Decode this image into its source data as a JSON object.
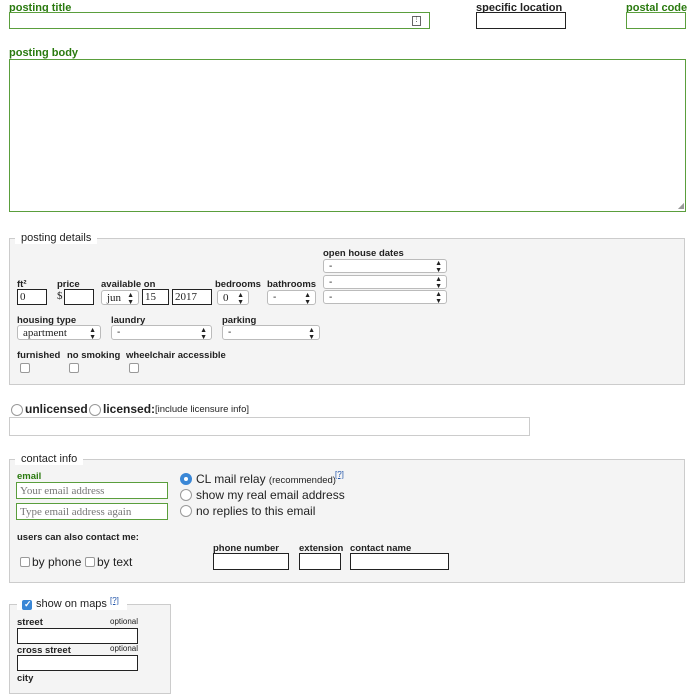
{
  "posting_title": {
    "label": "posting title",
    "value": ""
  },
  "specific_location": {
    "label": "specific location",
    "value": ""
  },
  "postal_code": {
    "label": "postal code",
    "value": ""
  },
  "posting_body": {
    "label": "posting body",
    "value": ""
  },
  "details": {
    "legend": "posting details",
    "open_house_label": "open house dates",
    "open_house_values": [
      "-",
      "-",
      "-"
    ],
    "ft2_label": "ft²",
    "ft2_value": "0",
    "price_label": "price",
    "price_symbol": "$",
    "price_value": "",
    "available_label": "available on",
    "available_month": "jun",
    "available_day": "15",
    "available_year": "2017",
    "bedrooms_label": "bedrooms",
    "bedrooms_value": "0",
    "bathrooms_label": "bathrooms",
    "bathrooms_value": "-",
    "housing_label": "housing type",
    "housing_value": "apartment",
    "laundry_label": "laundry",
    "laundry_value": "-",
    "parking_label": "parking",
    "parking_value": "-",
    "furnished_label": "furnished",
    "no_smoking_label": "no smoking",
    "wheelchair_label": "wheelchair accessible"
  },
  "license": {
    "unlicensed_label": "unlicensed",
    "licensed_label": "licensed:",
    "licensed_note": "[include licensure info]",
    "value": ""
  },
  "contact": {
    "legend": "contact info",
    "email_label": "email",
    "email_placeholder": "Your email address",
    "email_again_placeholder": "Type email address again",
    "relay_label": "CL mail relay",
    "relay_note": "(recommended)",
    "help_mark": "[?]",
    "real_email_label": "show my real email address",
    "no_replies_label": "no replies to this email",
    "also_contact_label": "users can also contact me:",
    "by_phone_label": "by phone",
    "by_text_label": "by text",
    "phone_label": "phone number",
    "extension_label": "extension",
    "contact_name_label": "contact name"
  },
  "maps": {
    "show_label": "show on maps",
    "help_mark": "[?]",
    "street_label": "street",
    "cross_street_label": "cross street",
    "optional_label": "optional",
    "city_label": "city"
  },
  "colors": {
    "accent_green": "#2a7a0f",
    "input_green_border": "#5a9e3c",
    "checkbox_blue": "#3a87d6"
  }
}
